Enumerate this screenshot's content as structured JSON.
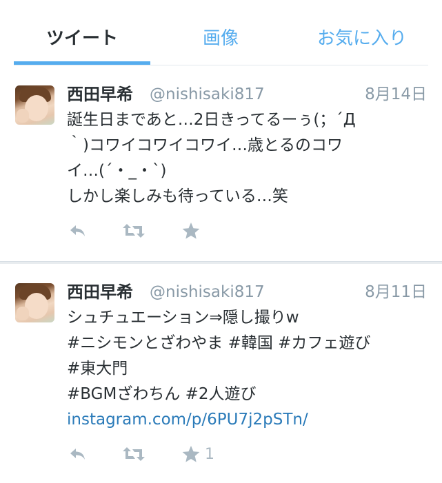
{
  "tabs": [
    {
      "label": "ツイート",
      "active": true
    },
    {
      "label": "画像",
      "active": false
    },
    {
      "label": "お気に入り",
      "active": false
    }
  ],
  "colors": {
    "accent": "#55acee",
    "text": "#292f33",
    "muted": "#8899a6",
    "link": "#2b7bb9",
    "action": "#aab8c2"
  },
  "tweets": [
    {
      "name": "西田早希",
      "handle": "@nishisaki817",
      "date": "8月14日",
      "lines": [
        "誕生日まであと…2日きってるーぅ(；´Д",
        "｀)コワイコワイコワイ…歳とるのコワ",
        "イ…(´・_・`)",
        "しかし楽しみも待っている…笑"
      ],
      "actions": {
        "reply_icon": "reply-icon",
        "retweet_icon": "retweet-icon",
        "favorite_icon": "star-icon",
        "favorite_count": ""
      }
    },
    {
      "name": "西田早希",
      "handle": "@nishisaki817",
      "date": "8月11日",
      "lines": [
        "シュチュエーション⇒隠し撮りw",
        "#ニシモンとざわやま #韓国 #カフェ遊び",
        "#東大門",
        "#BGMざわちん #2人遊び"
      ],
      "link": "instagram.com/p/6PU7j2pSTn/",
      "actions": {
        "reply_icon": "reply-icon",
        "retweet_icon": "retweet-icon",
        "favorite_icon": "star-icon",
        "favorite_count": "1"
      }
    }
  ]
}
